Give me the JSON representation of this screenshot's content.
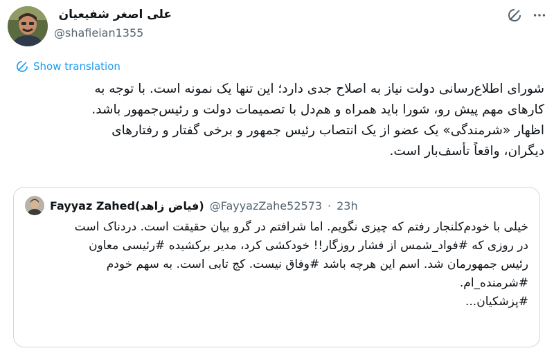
{
  "author": {
    "display_name": "علی اصغر شفیعیان",
    "handle": "@shafieian1355"
  },
  "icons": {
    "grok": "grok-icon",
    "more": "more-icon",
    "translate": "translate-icon"
  },
  "show_translation": "Show translation",
  "tweet_lines": [
    "شورای اطلاع‌رسانی دولت نیاز به اصلاح جدی دارد؛ این تنها یک نمونه است. با توجه به",
    "کارهای مهم پیش رو، شورا باید همراه و هم‌دل با تصمیمات دولت و رئیس‌جمهور باشد.",
    "اظهار «شرمندگی» یک عضو از یک انتصاب رئیس جمهور و برخی گفتار و رفتارهای",
    "دیگران، واقعاً تأسف‌بار است."
  ],
  "quote": {
    "name": "Fayyaz Zahed(فیاض زاهد)",
    "handle": "@FayyazZahe52573",
    "separator": "·",
    "time": "23h",
    "lines": [
      "خیلی با خودم‌کلنجار رفتم که چیزی نگویم. اما شرافتم در گرو بیان حقیقت است. دردناک است",
      "در روزی که #فواد_شمس از فشار روزگار!! خودکشی کرد، مدیر برکشیده #رئیسی معاون",
      "رئیس جمهورمان شد. اسم این هرچه باشد #وفاق نیست. کج تابی است. به سهم خودم",
      "#شرمنده_ام.",
      "#پزشکیان..."
    ]
  }
}
